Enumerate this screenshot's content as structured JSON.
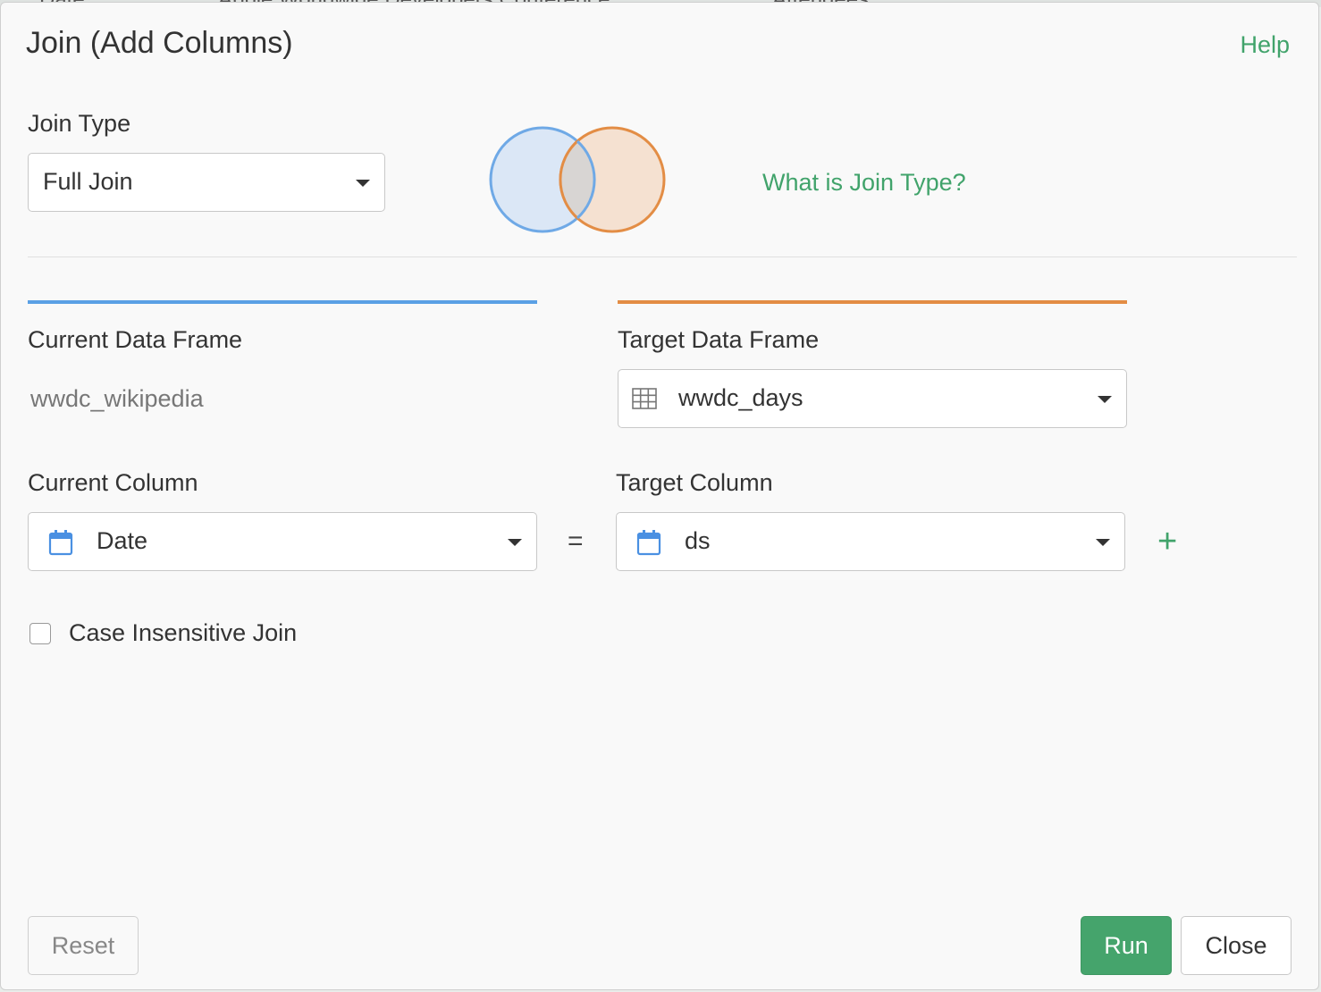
{
  "background": {
    "tabs": [
      "Date",
      "Apple Worldwide Developers Conference",
      "Attendees"
    ]
  },
  "dialog": {
    "title": "Join (Add Columns)",
    "help_label": "Help"
  },
  "join_type": {
    "label": "Join Type",
    "selected": "Full Join",
    "help_link": "What is Join Type?"
  },
  "current": {
    "frame_label": "Current Data Frame",
    "frame_value": "wwdc_wikipedia",
    "column_label": "Current Column",
    "column_value": "Date",
    "color": "#5aa0e5"
  },
  "target": {
    "frame_label": "Target Data Frame",
    "frame_value": "wwdc_days",
    "column_label": "Target Column",
    "column_value": "ds",
    "color": "#e38d45"
  },
  "operator": "=",
  "add_symbol": "+",
  "case_insensitive": {
    "label": "Case Insensitive Join",
    "checked": false
  },
  "buttons": {
    "reset": "Reset",
    "run": "Run",
    "close": "Close"
  },
  "accent_color": "#41a36b",
  "icons": [
    "chevron-down-icon",
    "table-icon",
    "calendar-icon",
    "plus-icon"
  ]
}
